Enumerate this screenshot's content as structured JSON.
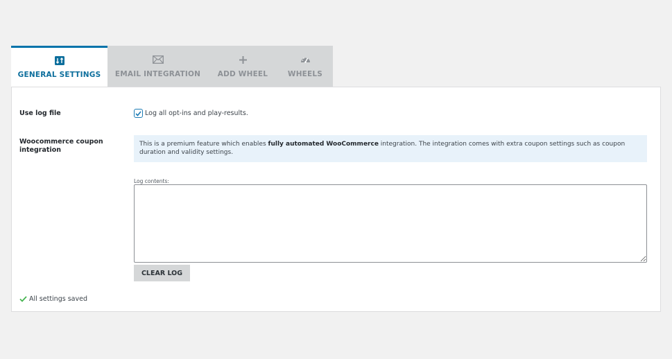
{
  "tabs": [
    {
      "label": "GENERAL SETTINGS",
      "icon": "sort-arrows-icon",
      "active": true
    },
    {
      "label": "EMAIL INTEGRATION",
      "icon": "envelope-icon",
      "active": false
    },
    {
      "label": "ADD WHEEL",
      "icon": "plus-icon",
      "active": false
    },
    {
      "label": "WHEELS",
      "icon": "dashboard-icon",
      "active": false
    }
  ],
  "settings": {
    "log_label": "Use log file",
    "log_checkbox_text": "Log all opt-ins and play-results.",
    "log_checkbox_checked": true,
    "coupon_label": "Woocommerce coupon integration",
    "notice_prefix": "This is a premium feature which enables ",
    "notice_bold": "fully automated WooCommerce",
    "notice_suffix": " integration. The integration comes with extra coupon settings such as coupon duration and validity settings.",
    "log_contents_label": "Log contents:",
    "log_contents_value": "",
    "clear_log_label": "CLEAR LOG",
    "saved_text": "All settings saved"
  },
  "colors": {
    "accent": "#0073aa",
    "active_tab_text": "#0c6e9c",
    "inactive_tab_bg": "#d5d7d8",
    "notice_bg": "#e8f2fa",
    "success": "#46b450"
  }
}
